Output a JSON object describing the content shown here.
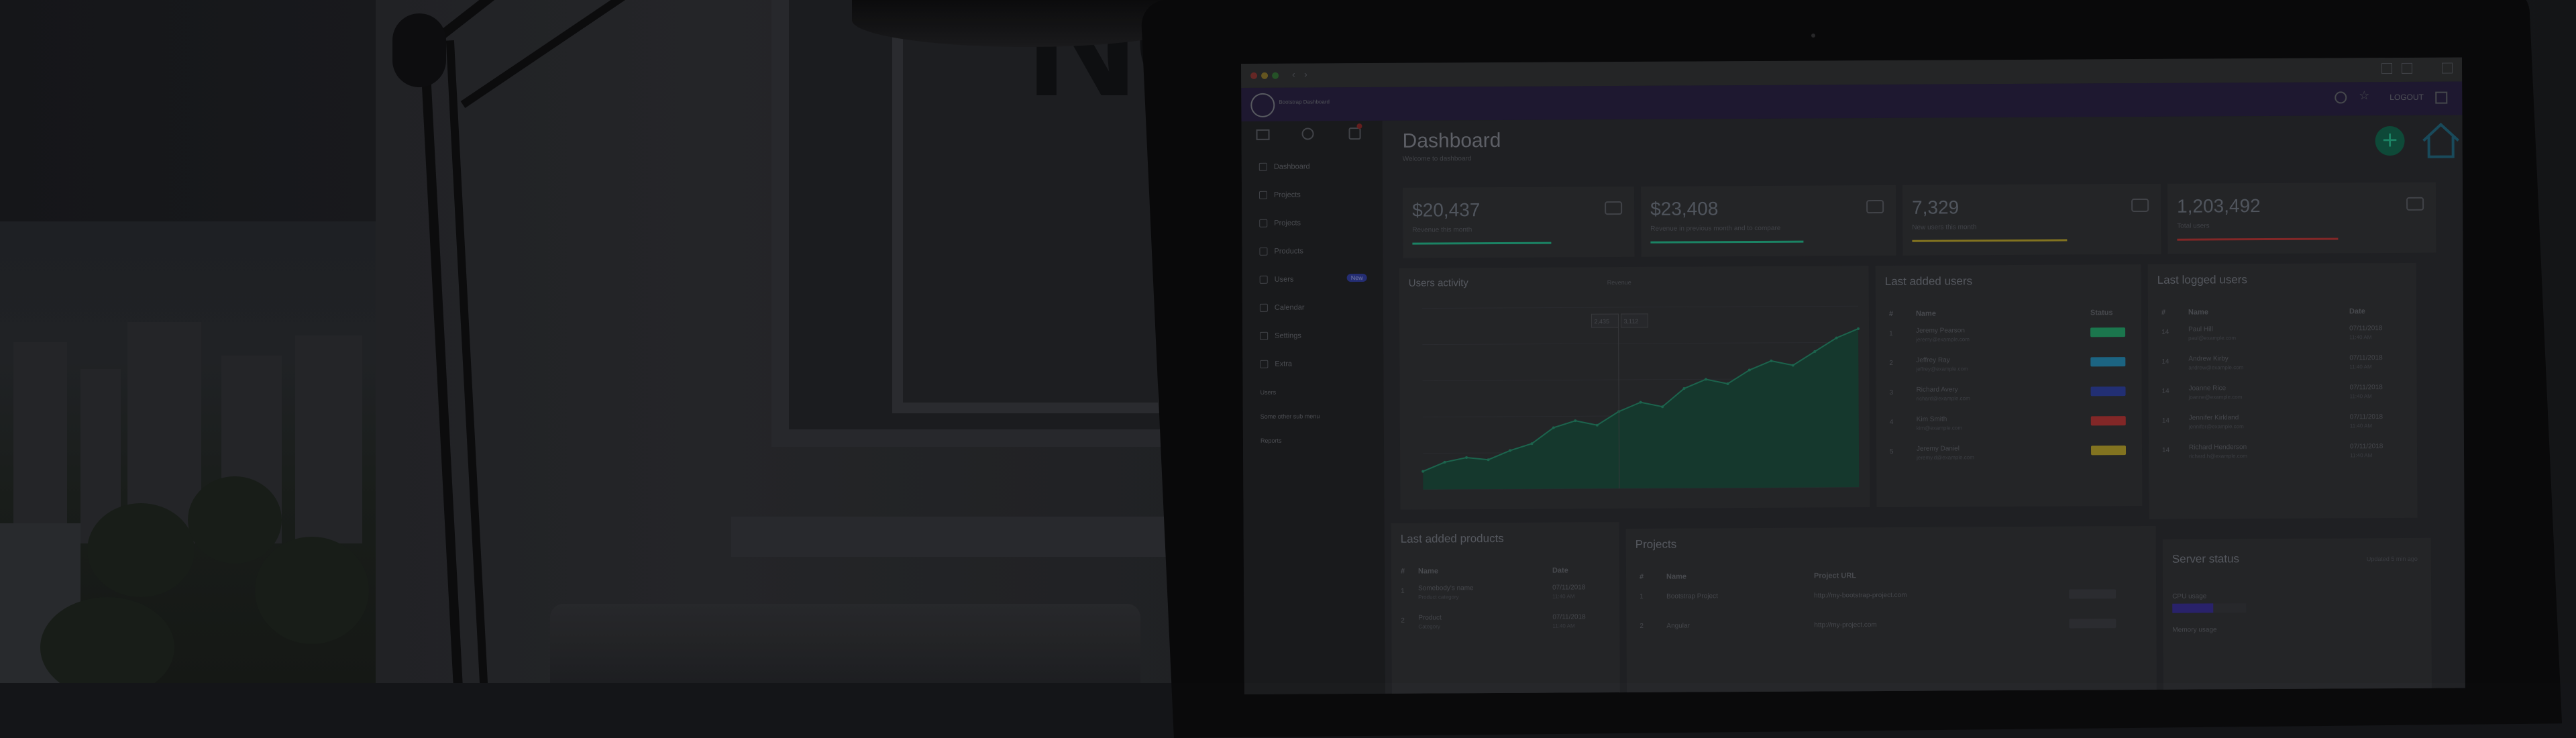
{
  "app": {
    "brand": "Bootstrap Dashboard",
    "header_right": "LOGOUT",
    "page_title": "Dashboard",
    "page_subtitle": "Welcome to dashboard"
  },
  "sidebar": {
    "items": [
      {
        "label": "Dashboard",
        "icon": "home-icon"
      },
      {
        "label": "Projects",
        "icon": "folder-icon"
      },
      {
        "label": "Projects",
        "icon": "list-icon"
      },
      {
        "label": "Products",
        "icon": "box-icon"
      },
      {
        "label": "Users",
        "icon": "user-icon",
        "badge": "New"
      },
      {
        "label": "Calendar",
        "icon": "calendar-icon"
      },
      {
        "label": "Settings",
        "icon": "gear-icon"
      },
      {
        "label": "Extra",
        "icon": "plus-icon"
      }
    ],
    "sub_items": [
      "Users",
      "Some other sub menu",
      "Reports"
    ]
  },
  "kpis": [
    {
      "value": "$20,437",
      "label": "Revenue this month",
      "color": "#1d8b6a",
      "icon": "cart-icon"
    },
    {
      "value": "$23,408",
      "label": "Revenue in previous month and to compare",
      "color": "#1d8b6a",
      "icon": "money-icon"
    },
    {
      "value": "7,329",
      "label": "New users this month",
      "color": "#8a7a22",
      "icon": "basket-icon"
    },
    {
      "value": "1,203,492",
      "label": "Total users",
      "color": "#8a2a2a",
      "icon": "card-icon"
    }
  ],
  "users_activity": {
    "title": "Users activity",
    "legend": "Revenue",
    "tooltip": [
      "2,435",
      "3,112"
    ]
  },
  "chart_data": {
    "type": "area",
    "title": "Users activity",
    "x": [
      0,
      1,
      2,
      3,
      4,
      5,
      6,
      7,
      8,
      9,
      10,
      11,
      12,
      13,
      14,
      15,
      16,
      17,
      18,
      19,
      20
    ],
    "y": [
      8,
      12,
      14,
      13,
      17,
      20,
      27,
      30,
      28,
      34,
      38,
      36,
      44,
      48,
      46,
      52,
      56,
      54,
      60,
      66,
      70
    ],
    "ylim": [
      0,
      80
    ],
    "grid": true
  },
  "last_added_users": {
    "title": "Last added users",
    "columns": [
      "#",
      "Name",
      "Status"
    ],
    "rows": [
      {
        "n": "1",
        "name": "Jeremy Pearson",
        "email": "jeremy@example.com",
        "status_color": "#1d7d52"
      },
      {
        "n": "2",
        "name": "Jeffrey Ray",
        "email": "jeffrey@example.com",
        "status_color": "#1e6a8a"
      },
      {
        "n": "3",
        "name": "Richard Avery",
        "email": "richard@example.com",
        "status_color": "#24327a"
      },
      {
        "n": "4",
        "name": "Kim Smith",
        "email": "kim@example.com",
        "status_color": "#8a2a2a"
      },
      {
        "n": "5",
        "name": "Jeremy Daniel",
        "email": "jeremy.d@example.com",
        "status_color": "#8a7a22"
      }
    ]
  },
  "last_logged_users": {
    "title": "Last logged users",
    "columns": [
      "#",
      "Name",
      "Date"
    ],
    "rows": [
      {
        "n": "14",
        "name": "Paul Hill",
        "email": "paul@example.com",
        "date": "07/11/2018",
        "time": "11:40 AM"
      },
      {
        "n": "14",
        "name": "Andrew Kirby",
        "email": "andrew@example.com",
        "date": "07/11/2018",
        "time": "11:40 AM"
      },
      {
        "n": "14",
        "name": "Joanne Rice",
        "email": "joanne@example.com",
        "date": "07/11/2018",
        "time": "11:40 AM"
      },
      {
        "n": "14",
        "name": "Jennifer Kirkland",
        "email": "jennifer@example.com",
        "date": "07/11/2018",
        "time": "11:40 AM"
      },
      {
        "n": "14",
        "name": "Richard Henderson",
        "email": "richard.h@example.com",
        "date": "07/11/2018",
        "time": "11:40 AM"
      }
    ]
  },
  "last_added_products": {
    "title": "Last added products",
    "columns": [
      "#",
      "Name",
      "Date"
    ],
    "rows": [
      {
        "n": "1",
        "name": "Somebody's name",
        "sub": "Product category",
        "date": "07/11/2018",
        "time": "11:40 AM"
      },
      {
        "n": "2",
        "name": "Product",
        "sub": "Category",
        "date": "07/11/2018",
        "time": "11:40 AM"
      }
    ]
  },
  "projects": {
    "title": "Projects",
    "columns": [
      "#",
      "Name",
      "Project URL"
    ],
    "rows": [
      {
        "n": "1",
        "name": "Bootstrap Project",
        "url": "http://my-bootstrap-project.com"
      },
      {
        "n": "2",
        "name": "Angular",
        "url": "http://my-project.com"
      }
    ]
  },
  "server_status": {
    "title": "Server status",
    "note": "Updated 5 min ago",
    "cpu_label": "CPU usage",
    "cpu_color": "#2c2470",
    "cpu_fraction": 0.55,
    "memory_label": "Memory usage"
  }
}
